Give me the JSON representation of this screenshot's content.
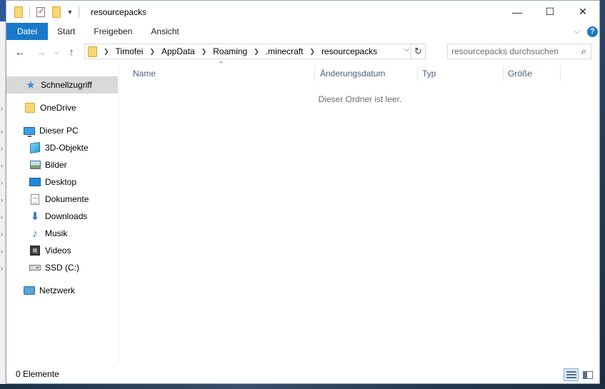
{
  "window": {
    "title": "resourcepacks"
  },
  "ribbon": {
    "tabs": [
      "Datei",
      "Start",
      "Freigeben",
      "Ansicht"
    ],
    "help_label": "?"
  },
  "address": {
    "crumbs": [
      "Timofei",
      "AppData",
      "Roaming",
      ".minecraft",
      "resourcepacks"
    ]
  },
  "search": {
    "placeholder": "resourcepacks durchsuchen"
  },
  "navpane": {
    "items": [
      {
        "label": "Schnellzugriff",
        "icon": "star-icon"
      },
      {
        "label": "OneDrive",
        "icon": "folder-icon"
      },
      {
        "label": "Dieser PC",
        "icon": "computer-icon"
      },
      {
        "label": "3D-Objekte",
        "icon": "cube-icon"
      },
      {
        "label": "Bilder",
        "icon": "pictures-icon"
      },
      {
        "label": "Desktop",
        "icon": "desktop-icon"
      },
      {
        "label": "Dokumente",
        "icon": "document-icon"
      },
      {
        "label": "Downloads",
        "icon": "download-arrow-icon"
      },
      {
        "label": "Musik",
        "icon": "music-note-icon"
      },
      {
        "label": "Videos",
        "icon": "film-icon"
      },
      {
        "label": "SSD (C:)",
        "icon": "drive-icon"
      },
      {
        "label": "Netzwerk",
        "icon": "network-icon"
      }
    ]
  },
  "columns": {
    "name": "Name",
    "modified": "Änderungsdatum",
    "type": "Typ",
    "size": "Größe"
  },
  "content": {
    "empty_message": "Dieser Ordner ist leer."
  },
  "status": {
    "item_count": "0 Elemente"
  },
  "colors": {
    "accent": "#1979ca",
    "selected_bg": "#d9d9d9"
  }
}
